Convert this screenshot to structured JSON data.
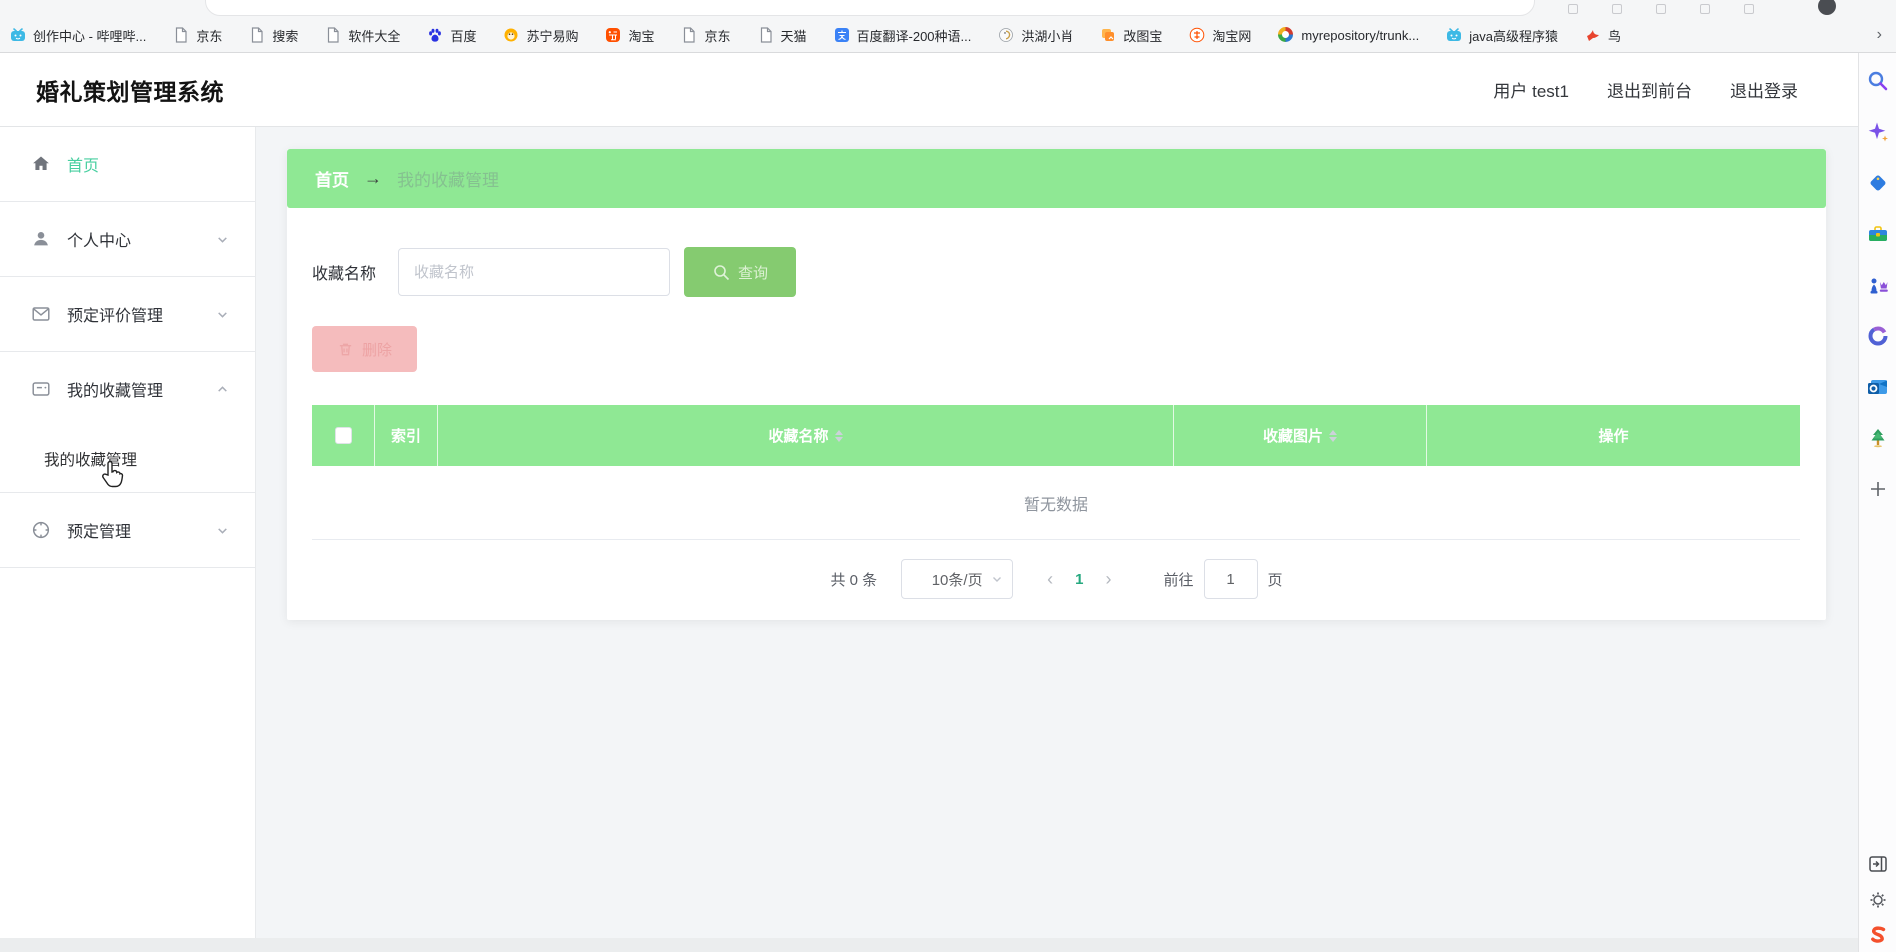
{
  "browser": {
    "bookmarks": [
      {
        "label": "创作中心 - 哔哩哔...",
        "icon": "bilibili"
      },
      {
        "label": "京东",
        "icon": "doc"
      },
      {
        "label": "搜索",
        "icon": "doc"
      },
      {
        "label": "软件大全",
        "icon": "doc"
      },
      {
        "label": "百度",
        "icon": "baidu"
      },
      {
        "label": "苏宁易购",
        "icon": "suning"
      },
      {
        "label": "淘宝",
        "icon": "taobao"
      },
      {
        "label": "京东",
        "icon": "doc"
      },
      {
        "label": "天猫",
        "icon": "doc"
      },
      {
        "label": "百度翻译-200种语...",
        "icon": "translate"
      },
      {
        "label": "洪湖小肖",
        "icon": "rooster"
      },
      {
        "label": "改图宝",
        "icon": "gaitubao"
      },
      {
        "label": "淘宝网",
        "icon": "taobao2"
      },
      {
        "label": "myrepository/trunk...",
        "icon": "swirl"
      },
      {
        "label": "java高级程序猿",
        "icon": "bilibili"
      },
      {
        "label": "鸟",
        "icon": "bird"
      }
    ],
    "overflow_chevron": "›"
  },
  "header": {
    "title": "婚礼策划管理系统",
    "user": "用户 test1",
    "links": [
      {
        "label": "退出到前台"
      },
      {
        "label": "退出登录"
      }
    ]
  },
  "sidebar": {
    "items": [
      {
        "label": "首页",
        "icon": "home",
        "active": true,
        "divider": true
      },
      {
        "label": "个人中心",
        "icon": "user",
        "chevron": "down",
        "divider": true
      },
      {
        "label": "预定评价管理",
        "icon": "mail",
        "chevron": "down",
        "divider": true
      },
      {
        "label": "我的收藏管理",
        "icon": "card",
        "chevron": "up",
        "divider": false,
        "children": [
          {
            "label": "我的收藏管理",
            "divider": true
          }
        ]
      },
      {
        "label": "预定管理",
        "icon": "compass",
        "chevron": "down",
        "divider": true
      }
    ]
  },
  "breadcrumb": {
    "home": "首页",
    "arrow": "→",
    "current": "我的收藏管理"
  },
  "search": {
    "label": "收藏名称",
    "placeholder": "收藏名称",
    "button": "查询"
  },
  "toolbar": {
    "delete_label": "删除"
  },
  "table": {
    "columns": [
      {
        "label": "",
        "type": "checkbox"
      },
      {
        "label": "索引"
      },
      {
        "label": "收藏名称",
        "sortable": true
      },
      {
        "label": "收藏图片",
        "sortable": true
      },
      {
        "label": "操作"
      }
    ],
    "empty_text": "暂无数据"
  },
  "pagination": {
    "total": "共 0 条",
    "page_size": "10条/页",
    "prev": "‹",
    "active_page": "1",
    "next": "›",
    "goto_label": "前往",
    "goto_value": "1",
    "goto_unit": "页"
  },
  "edge_sidebar": {
    "top_icons": [
      "search",
      "copilot",
      "shopping-tag",
      "toolbox",
      "games",
      "microsoft-365",
      "outlook",
      "tree",
      "add"
    ],
    "bottom_icons": [
      "open-panel",
      "settings",
      "screenshot-logo"
    ]
  },
  "colors": {
    "green": "#8fe894",
    "button_green": "#85cb70",
    "accent_teal": "#48cfa0",
    "active_page_teal": "#26a97f",
    "pink": "#f5bcbd"
  }
}
